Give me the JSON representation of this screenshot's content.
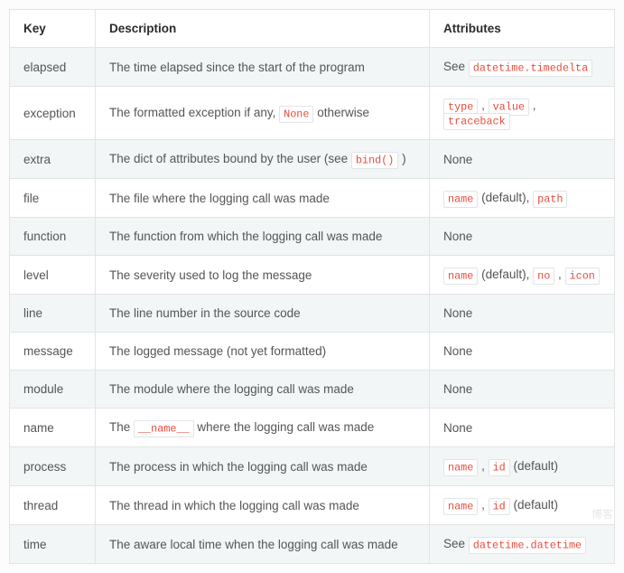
{
  "headers": {
    "key": "Key",
    "desc": "Description",
    "attr": "Attributes"
  },
  "watermark": "博客",
  "rows": [
    {
      "key": "elapsed",
      "desc": [
        {
          "t": "text",
          "v": "The time elapsed since the start of the program"
        }
      ],
      "attr": [
        {
          "t": "text",
          "v": "See "
        },
        {
          "t": "code",
          "v": "datetime.timedelta"
        }
      ]
    },
    {
      "key": "exception",
      "desc": [
        {
          "t": "text",
          "v": "The formatted exception if any, "
        },
        {
          "t": "code",
          "v": "None"
        },
        {
          "t": "text",
          "v": " otherwise"
        }
      ],
      "attr": [
        {
          "t": "code",
          "v": "type"
        },
        {
          "t": "text",
          "v": " , "
        },
        {
          "t": "code",
          "v": "value"
        },
        {
          "t": "text",
          "v": " , "
        },
        {
          "t": "code",
          "v": "traceback"
        }
      ]
    },
    {
      "key": "extra",
      "desc": [
        {
          "t": "text",
          "v": "The dict of attributes bound by the user (see "
        },
        {
          "t": "code",
          "v": "bind()"
        },
        {
          "t": "text",
          "v": " )"
        }
      ],
      "attr": [
        {
          "t": "text",
          "v": "None"
        }
      ]
    },
    {
      "key": "file",
      "desc": [
        {
          "t": "text",
          "v": "The file where the logging call was made"
        }
      ],
      "attr": [
        {
          "t": "code",
          "v": "name"
        },
        {
          "t": "text",
          "v": " (default), "
        },
        {
          "t": "code",
          "v": "path"
        }
      ]
    },
    {
      "key": "function",
      "desc": [
        {
          "t": "text",
          "v": "The function from which the logging call was made"
        }
      ],
      "attr": [
        {
          "t": "text",
          "v": "None"
        }
      ]
    },
    {
      "key": "level",
      "desc": [
        {
          "t": "text",
          "v": "The severity used to log the message"
        }
      ],
      "attr": [
        {
          "t": "code",
          "v": "name"
        },
        {
          "t": "text",
          "v": " (default), "
        },
        {
          "t": "code",
          "v": "no"
        },
        {
          "t": "text",
          "v": " , "
        },
        {
          "t": "code",
          "v": "icon"
        }
      ]
    },
    {
      "key": "line",
      "desc": [
        {
          "t": "text",
          "v": "The line number in the source code"
        }
      ],
      "attr": [
        {
          "t": "text",
          "v": "None"
        }
      ]
    },
    {
      "key": "message",
      "desc": [
        {
          "t": "text",
          "v": "The logged message (not yet formatted)"
        }
      ],
      "attr": [
        {
          "t": "text",
          "v": "None"
        }
      ]
    },
    {
      "key": "module",
      "desc": [
        {
          "t": "text",
          "v": "The module where the logging call was made"
        }
      ],
      "attr": [
        {
          "t": "text",
          "v": "None"
        }
      ]
    },
    {
      "key": "name",
      "desc": [
        {
          "t": "text",
          "v": "The "
        },
        {
          "t": "code",
          "v": "__name__"
        },
        {
          "t": "text",
          "v": " where the logging call was made"
        }
      ],
      "attr": [
        {
          "t": "text",
          "v": "None"
        }
      ]
    },
    {
      "key": "process",
      "desc": [
        {
          "t": "text",
          "v": "The process in which the logging call was made"
        }
      ],
      "attr": [
        {
          "t": "code",
          "v": "name"
        },
        {
          "t": "text",
          "v": " , "
        },
        {
          "t": "code",
          "v": "id"
        },
        {
          "t": "text",
          "v": " (default)"
        }
      ]
    },
    {
      "key": "thread",
      "desc": [
        {
          "t": "text",
          "v": "The thread in which the logging call was made"
        }
      ],
      "attr": [
        {
          "t": "code",
          "v": "name"
        },
        {
          "t": "text",
          "v": " , "
        },
        {
          "t": "code",
          "v": "id"
        },
        {
          "t": "text",
          "v": " (default)"
        }
      ]
    },
    {
      "key": "time",
      "desc": [
        {
          "t": "text",
          "v": "The aware local time when the logging call was made"
        }
      ],
      "attr": [
        {
          "t": "text",
          "v": "See "
        },
        {
          "t": "code",
          "v": "datetime.datetime"
        }
      ]
    }
  ]
}
